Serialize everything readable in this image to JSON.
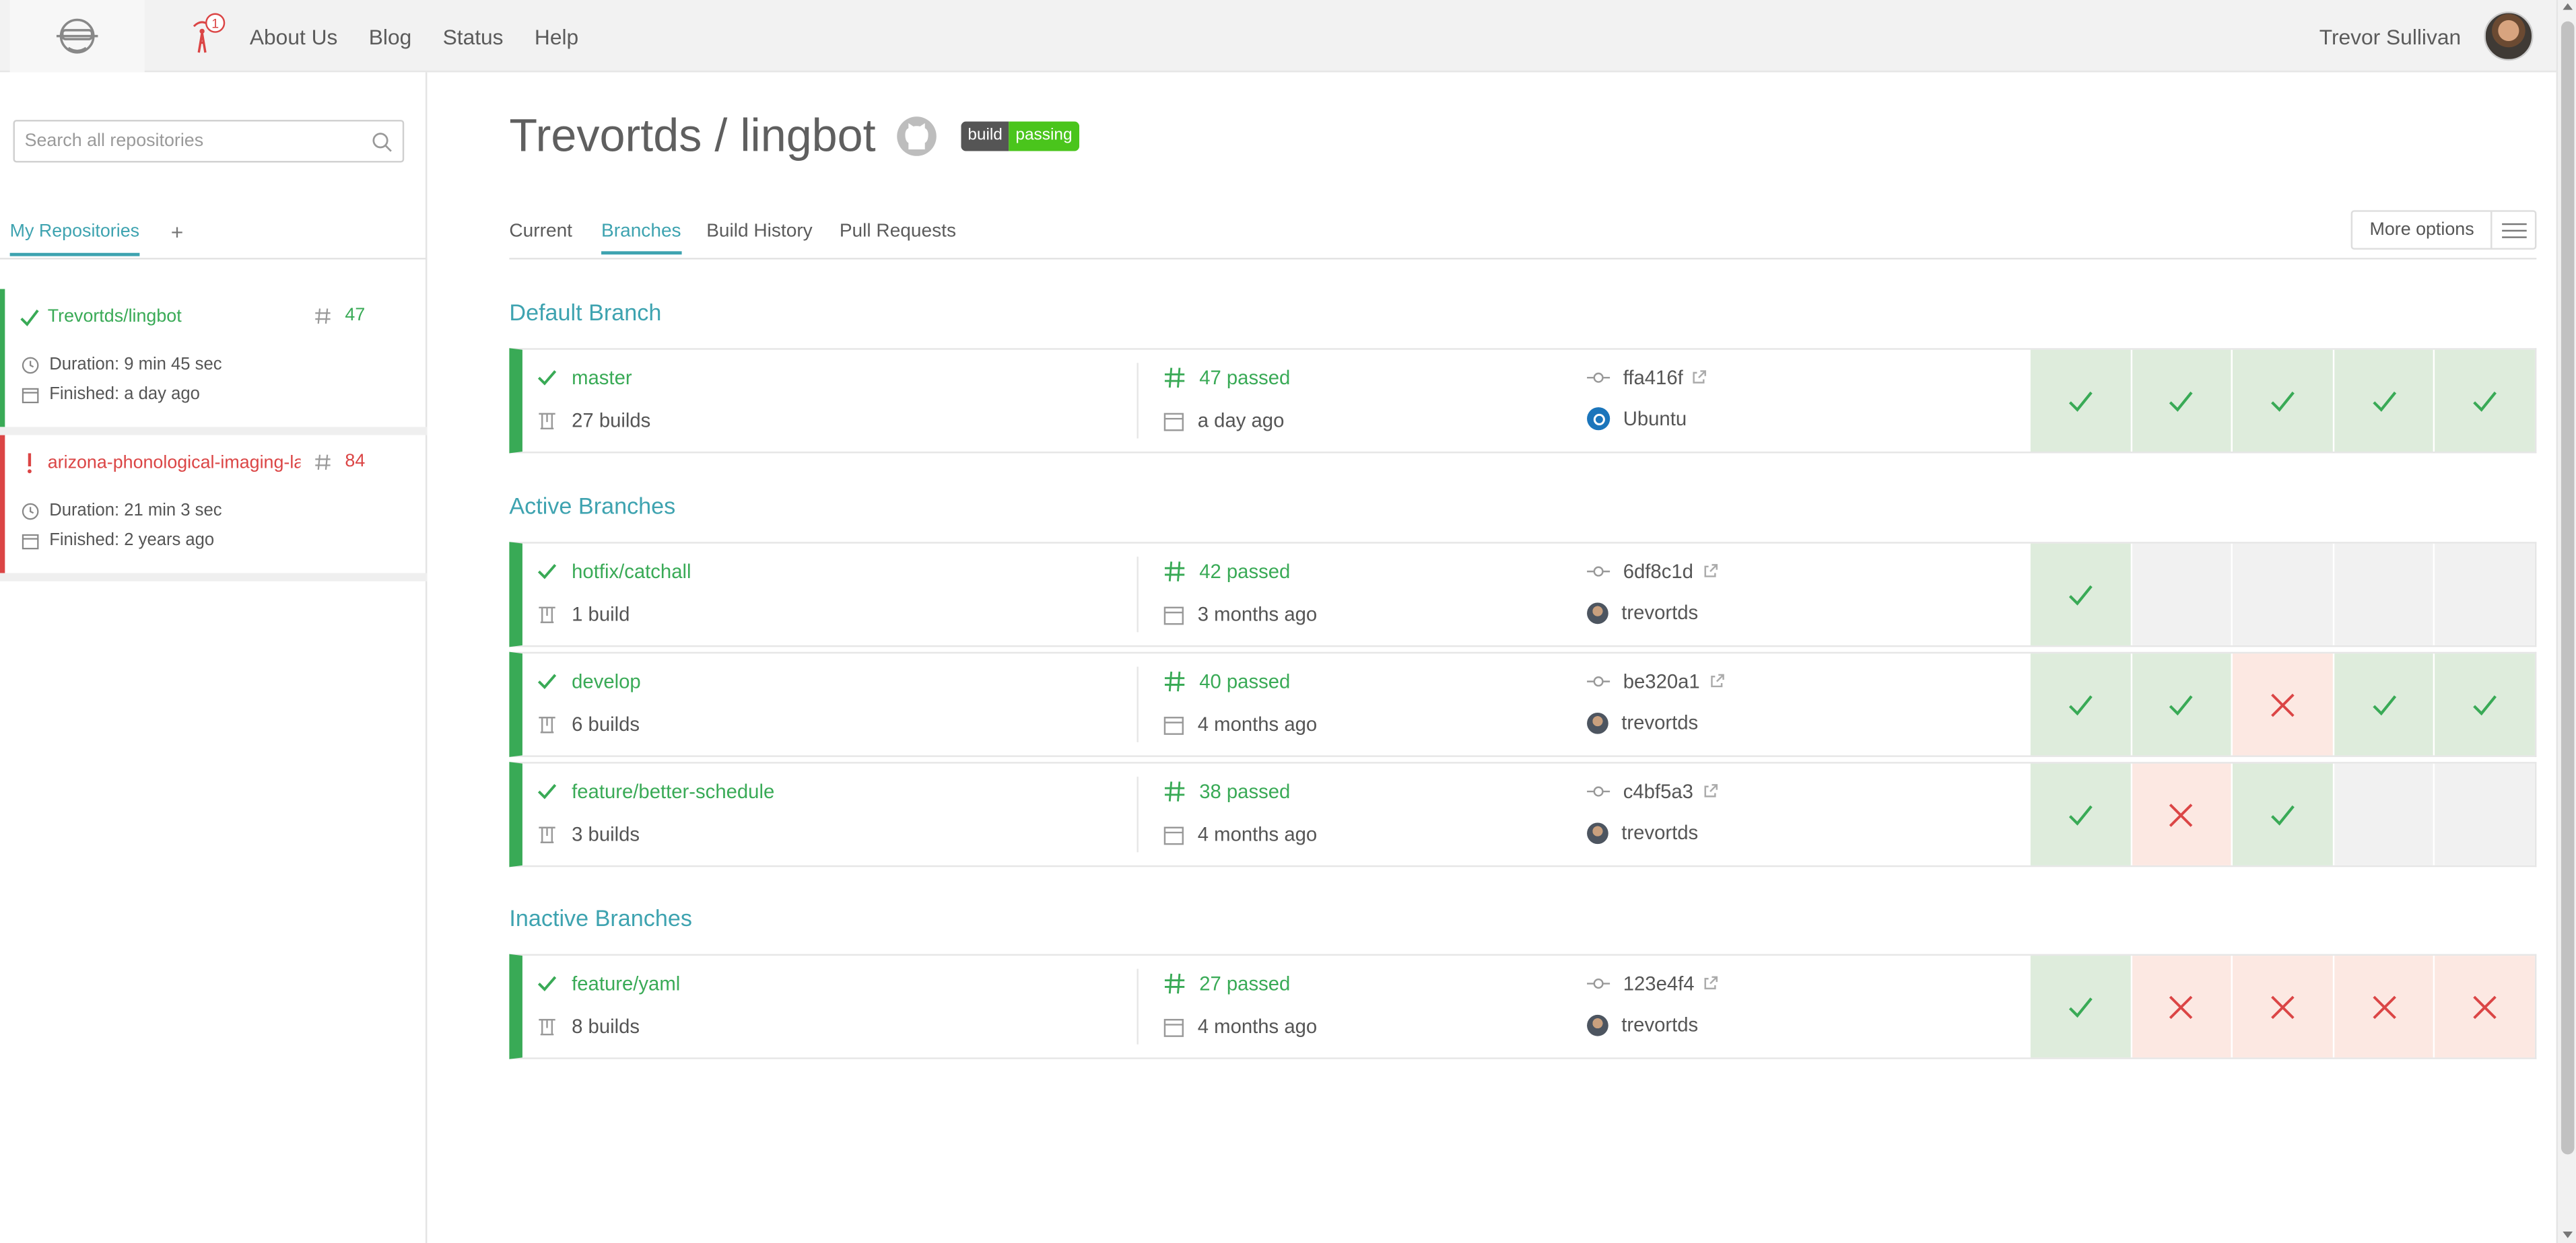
{
  "nav": {
    "links": [
      "About Us",
      "Blog",
      "Status",
      "Help"
    ],
    "user_name": "Trevor Sullivan",
    "broadcast_count": "1"
  },
  "sidebar": {
    "search_placeholder": "Search all repositories",
    "tab_label": "My Repositories",
    "add_label": "+",
    "repos": [
      {
        "name": "Trevortds/lingbot",
        "number": "47",
        "status": "passed",
        "duration": "Duration: 9 min 45 sec",
        "finished": "Finished: a day ago"
      },
      {
        "name": "arizona-phonological-imaging-lab/...",
        "number": "84",
        "status": "failed",
        "duration": "Duration: 21 min 3 sec",
        "finished": "Finished: 2 years ago"
      }
    ]
  },
  "repo": {
    "title": "Trevortds / lingbot",
    "badge_left": "build",
    "badge_right": "passing"
  },
  "tabs": [
    "Current",
    "Branches",
    "Build History",
    "Pull Requests"
  ],
  "active_tab": "Branches",
  "more_options_label": "More options",
  "sections": {
    "default": "Default Branch",
    "active": "Active Branches",
    "inactive": "Inactive Branches"
  },
  "branches": [
    {
      "name": "master",
      "builds": "27 builds",
      "passed": "47 passed",
      "date": "a day ago",
      "commit": "ffa416f",
      "author": "Ubuntu",
      "author_icon": "ubuntu-icon",
      "history": [
        "passed",
        "passed",
        "passed",
        "passed",
        "passed"
      ]
    },
    {
      "name": "hotfix/catchall",
      "builds": "1 build",
      "passed": "42 passed",
      "date": "3 months ago",
      "commit": "6df8c1d",
      "author": "trevortds",
      "author_icon": "avatar",
      "history": [
        "passed",
        "empty",
        "empty",
        "empty",
        "empty"
      ]
    },
    {
      "name": "develop",
      "builds": "6 builds",
      "passed": "40 passed",
      "date": "4 months ago",
      "commit": "be320a1",
      "author": "trevortds",
      "author_icon": "avatar",
      "history": [
        "passed",
        "passed",
        "failed",
        "passed",
        "passed"
      ]
    },
    {
      "name": "feature/better-schedule",
      "builds": "3 builds",
      "passed": "38 passed",
      "date": "4 months ago",
      "commit": "c4bf5a3",
      "author": "trevortds",
      "author_icon": "avatar",
      "history": [
        "passed",
        "failed",
        "passed",
        "empty",
        "empty"
      ]
    },
    {
      "name": "feature/yaml",
      "builds": "8 builds",
      "passed": "27 passed",
      "date": "4 months ago",
      "commit": "123e4f4",
      "author": "trevortds",
      "author_icon": "avatar",
      "history": [
        "passed",
        "failed",
        "failed",
        "failed",
        "failed"
      ]
    }
  ],
  "colors": {
    "passed": "#39aa56",
    "failed": "#db4545",
    "accent": "#3ea3b0"
  }
}
